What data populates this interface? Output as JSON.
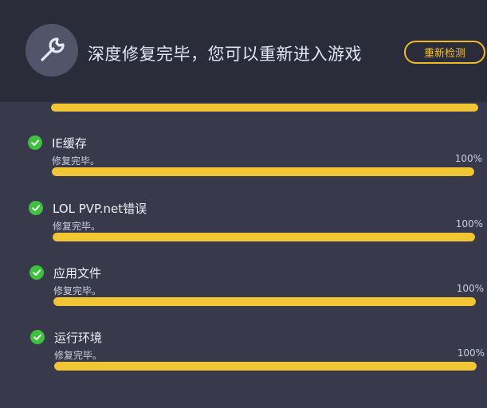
{
  "header": {
    "title": "深度修复完毕，您可以重新进入游戏",
    "recheck_label": "重新检测",
    "icon": "wrench-icon"
  },
  "items": [
    {
      "name": "IE缓存",
      "status": "修复完毕。",
      "percent_label": "100%",
      "progress": 1.0,
      "icon": "check-icon"
    },
    {
      "name": "LOL PVP.net错误",
      "status": "修复完毕。",
      "percent_label": "100%",
      "progress": 1.0,
      "icon": "check-icon"
    },
    {
      "name": "应用文件",
      "status": "修复完毕。",
      "percent_label": "100%",
      "progress": 1.0,
      "icon": "check-icon"
    },
    {
      "name": "运行环境",
      "status": "修复完毕。",
      "percent_label": "100%",
      "progress": 1.0,
      "icon": "check-icon"
    }
  ],
  "colors": {
    "accent": "#f1c534",
    "check": "#3fc13f",
    "header_bg": "#2b2c3a",
    "body_bg": "#383a4b"
  }
}
